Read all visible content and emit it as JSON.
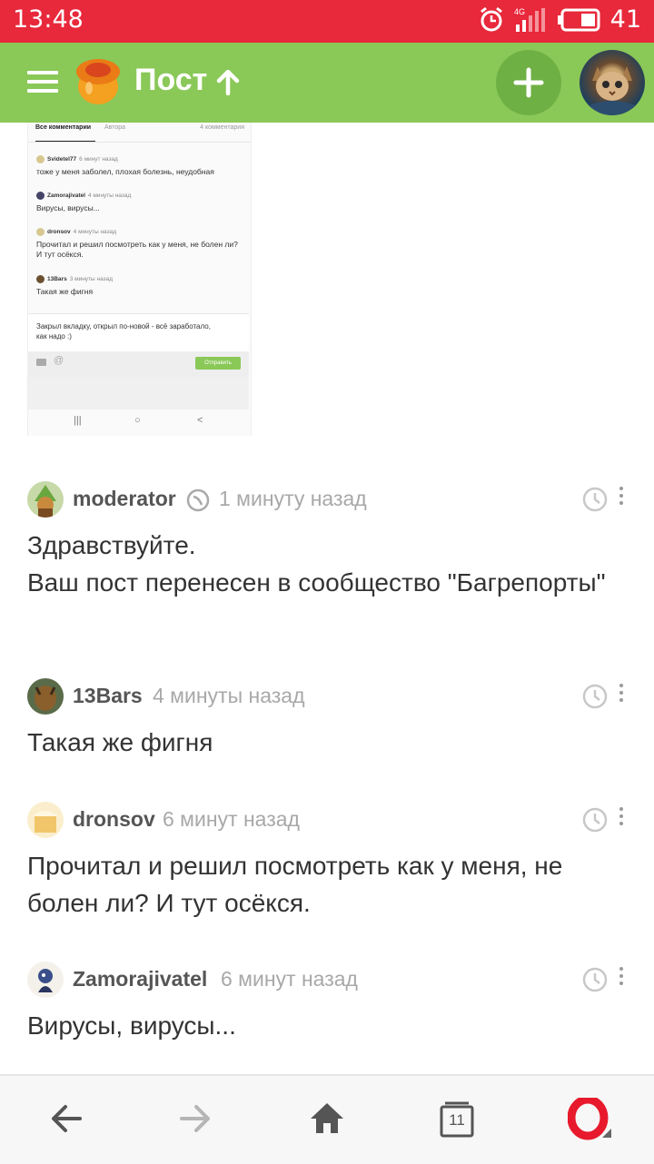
{
  "status_bar": {
    "time": "13:48",
    "signal_label": "4G",
    "battery_level": "41",
    "icons": [
      "alarm-icon",
      "signal-icon",
      "battery-icon"
    ]
  },
  "top_bar": {
    "title": "Пост",
    "icons": [
      "menu-icon",
      "site-logo",
      "arrow-up-icon",
      "add-icon",
      "user-avatar"
    ]
  },
  "embedded_screenshot": {
    "tabs": [
      "Все комментарии",
      "Автора"
    ],
    "comment_count": "4 комментария",
    "comments": [
      {
        "author": "Svidetel77",
        "time": "6 минут назад",
        "text": "тоже у меня заболел, плохая болезнь, неудобная"
      },
      {
        "author": "Zamorajivatel",
        "time": "4 минуты назад",
        "text": "Вирусы, вирусы..."
      },
      {
        "author": "dronsov",
        "time": "4 минуты назад",
        "text": "Прочитал и решил посмотреть как у меня, не болен ли? И тут осёкся."
      },
      {
        "author": "13Bars",
        "time": "3 минуты назад",
        "text": "Такая же фигня"
      }
    ],
    "input_text": "Закрыл вкладку, открыл по-новой - всё заработало, как надо :)",
    "send_label": "Отправить",
    "nav_icons": [
      "|||",
      "○",
      "<"
    ]
  },
  "comments": [
    {
      "author": "moderator",
      "time": "1 минуту назад",
      "text": "Здравствуйте.\nВаш пост перенесен в сообщество \"Багрепорты\""
    },
    {
      "author": "13Bars",
      "time": "4 минуты назад",
      "text": "Такая же фигня"
    },
    {
      "author": "dronsov",
      "time": "6 минут назад",
      "text": "Прочитал и решил посмотреть как у меня, не болен ли? И тут осёкся."
    },
    {
      "author": "Zamorajivatel",
      "time": "6 минут назад",
      "text": "Вирусы, вирусы..."
    }
  ],
  "bottom_bar": {
    "tab_count": "11",
    "icons": [
      "back-icon",
      "forward-icon",
      "home-icon",
      "tabs-icon",
      "opera-menu-icon"
    ]
  },
  "colors": {
    "status_bar": "#e8283b",
    "top_bar": "#8ac858",
    "accent_dark": "#6fb044"
  }
}
